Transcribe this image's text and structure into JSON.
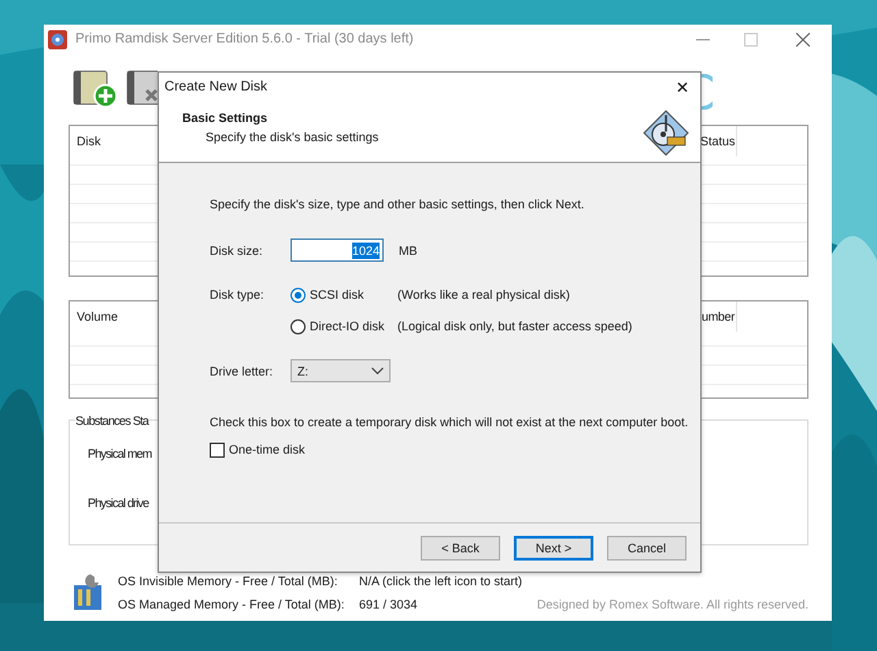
{
  "main_window": {
    "title": "Primo Ramdisk Server Edition 5.6.0 - Trial (30 days left)",
    "disk_table": {
      "columns": [
        "Disk",
        "Status"
      ]
    },
    "volume_table": {
      "columns": [
        "Volume",
        "umber"
      ]
    },
    "substances_status": {
      "title": "Substances Sta",
      "labels": [
        "Physical mem",
        "Physical drive"
      ]
    },
    "memory_info": [
      {
        "label": "OS Invisible Memory - Free / Total (MB):",
        "value": "N/A (click the left icon to start)"
      },
      {
        "label": "OS Managed Memory - Free / Total (MB):",
        "value": "691 / 3034"
      }
    ],
    "credit": "Designed by Romex Software. All rights reserved."
  },
  "dialog": {
    "title": "Create New Disk",
    "close": "✕",
    "header": {
      "title": "Basic Settings",
      "subtitle": "Specify the disk's basic settings"
    },
    "intro": "Specify the disk's size, type and other basic settings, then click Next.",
    "disk_size": {
      "label": "Disk size:",
      "value": "1024",
      "text_selected": true,
      "unit": "MB"
    },
    "disk_type": {
      "label": "Disk type:",
      "options": [
        {
          "label": "SCSI disk",
          "description": "(Works like a real physical disk)",
          "selected": true
        },
        {
          "label": "Direct-IO disk",
          "description": "(Logical disk only, but faster access speed)",
          "selected": false
        }
      ]
    },
    "drive_letter": {
      "label": "Drive letter:",
      "value": "Z:"
    },
    "one_time": {
      "hint": "Check this box to create a temporary disk which will not exist at the next computer boot.",
      "label": "One-time disk",
      "checked": false
    },
    "buttons": [
      {
        "label": "< Back",
        "default": false
      },
      {
        "label": "Next >",
        "default": true
      },
      {
        "label": "Cancel",
        "default": false
      }
    ]
  }
}
